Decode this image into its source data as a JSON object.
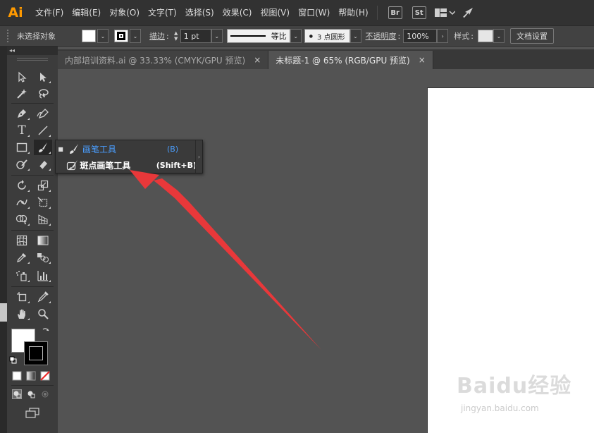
{
  "app": {
    "logo": "Ai"
  },
  "menu": [
    {
      "label": "文件(F)"
    },
    {
      "label": "编辑(E)"
    },
    {
      "label": "对象(O)"
    },
    {
      "label": "文字(T)"
    },
    {
      "label": "选择(S)"
    },
    {
      "label": "效果(C)"
    },
    {
      "label": "视图(V)"
    },
    {
      "label": "窗口(W)"
    },
    {
      "label": "帮助(H)"
    }
  ],
  "menu_icons": {
    "br": "Br",
    "st": "St",
    "workspace_icon": "layout-grid-icon",
    "sync_icon": "rocket-icon"
  },
  "control": {
    "selection_label": "未选择对象",
    "stroke_label": "描边",
    "stroke_weight": "1 pt",
    "profile_label": "等比",
    "brush_label": "3 点圆形",
    "opacity_label": "不透明度",
    "opacity_value": "100%",
    "style_label": "样式",
    "doc_setup": "文档设置"
  },
  "tabs": [
    {
      "label": "内部培训资料.ai @ 33.33% (CMYK/GPU 预览)",
      "close": "×",
      "active": false
    },
    {
      "label": "未标题-1 @ 65% (RGB/GPU 预览)",
      "close": "×",
      "active": true
    }
  ],
  "toolbar": {
    "collapse": "◂◂"
  },
  "flyout": {
    "items": [
      {
        "label": "画笔工具",
        "shortcut": "(B)",
        "selected": true,
        "color": "#4a9eff"
      },
      {
        "label": "斑点画笔工具",
        "shortcut": "(Shift+B)",
        "selected": false,
        "color": "#ffffff"
      }
    ]
  },
  "annotation": {
    "arrow_color": "#e8383a"
  },
  "watermark": {
    "main": "Baidu经验",
    "sub": "jingyan.baidu.com"
  }
}
